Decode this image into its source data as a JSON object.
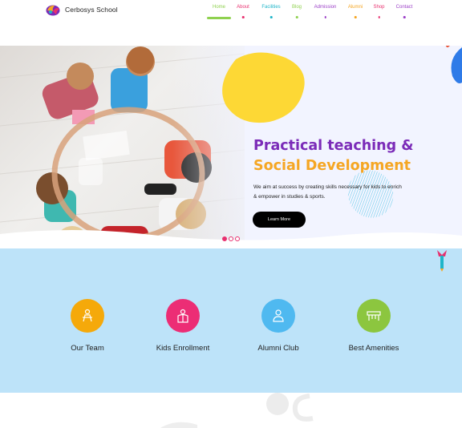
{
  "brand": {
    "name": "Cerbosys School"
  },
  "nav": {
    "items": [
      {
        "label": "Home",
        "color": "#8fd14f",
        "active": true
      },
      {
        "label": "About",
        "color": "#e8306f"
      },
      {
        "label": "Facilities",
        "color": "#1fb5c9"
      },
      {
        "label": "Blog",
        "color": "#8fd14f"
      },
      {
        "label": "Admission",
        "color": "#9b3fc7"
      },
      {
        "label": "Alumni",
        "color": "#f5a623"
      },
      {
        "label": "Shop",
        "color": "#e8306f"
      },
      {
        "label": "Contact",
        "color": "#9b3fc7"
      }
    ]
  },
  "hero": {
    "title_line1": "Practical teaching &",
    "title_line2": "Social Development",
    "description": "We aim at success by creating skills necessary for kids to enrich & empower in studies & sports.",
    "cta_label": "Learn More",
    "slides": 3,
    "active_slide": 1
  },
  "features": [
    {
      "label": "Our Team",
      "color": "#f5a90a",
      "icon": "team-icon"
    },
    {
      "label": "Kids Enrollment",
      "color": "#ec2d75",
      "icon": "enrollment-icon"
    },
    {
      "label": "Alumni Club",
      "color": "#4fb9f0",
      "icon": "alumni-icon"
    },
    {
      "label": "Best Amenities",
      "color": "#8cc63f",
      "icon": "amenities-icon"
    }
  ],
  "colors": {
    "purple": "#7b2bb8",
    "orange": "#f5a623",
    "hero_bg": "#f2f4ff",
    "features_bg": "#bde3f9"
  }
}
